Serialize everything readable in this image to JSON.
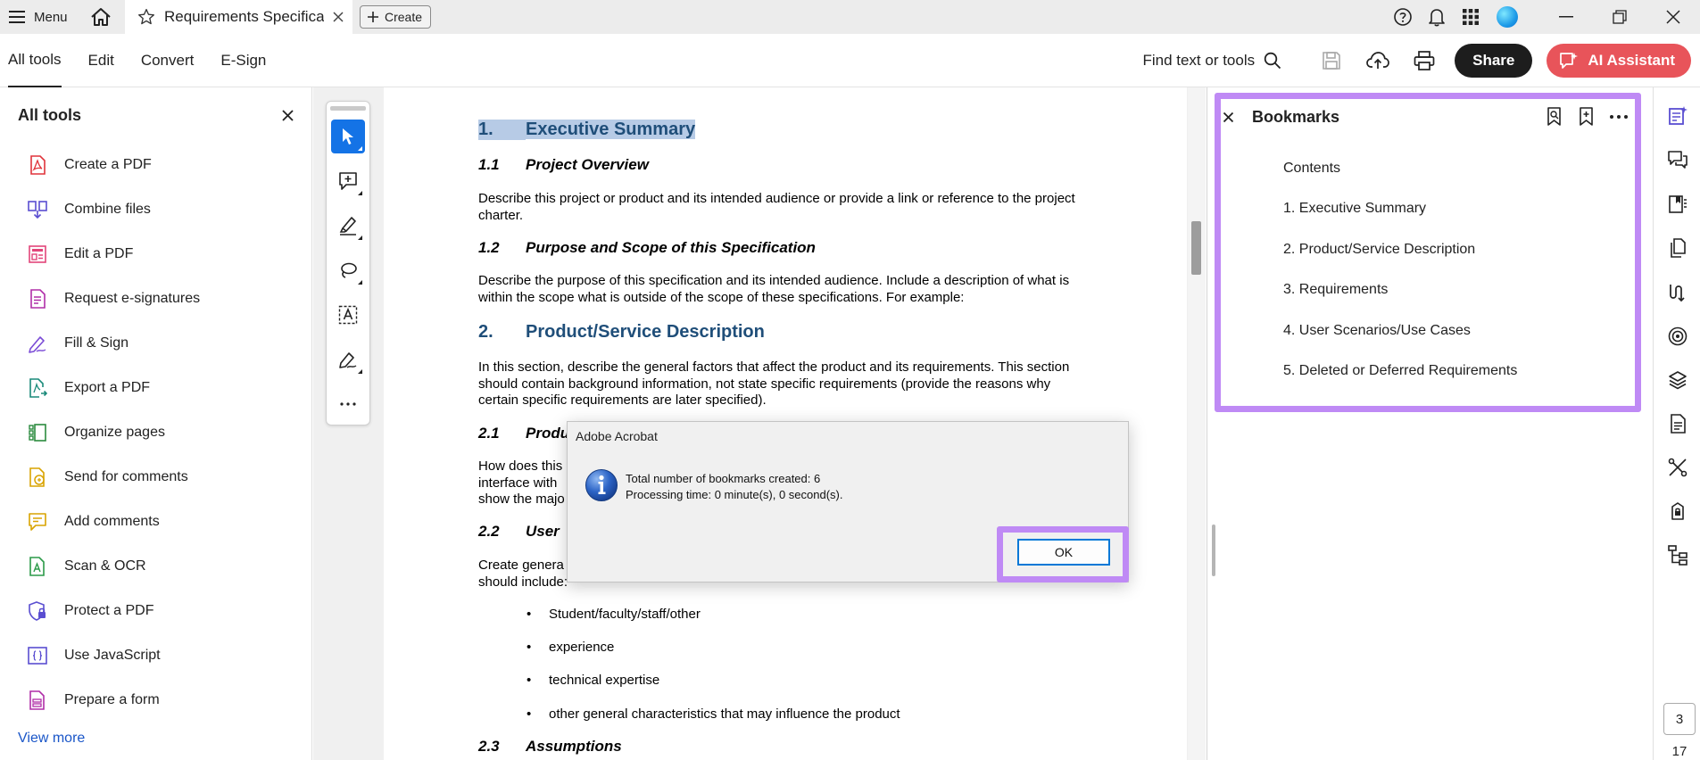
{
  "titlebar": {
    "menu_label": "Menu",
    "tab_title": "Requirements Specifica...",
    "create_label": "Create"
  },
  "toolbar": {
    "tabs": [
      {
        "label": "All tools",
        "active": true
      },
      {
        "label": "Edit"
      },
      {
        "label": "Convert"
      },
      {
        "label": "E-Sign"
      }
    ],
    "find_label": "Find text or tools",
    "share_label": "Share",
    "ai_label": "AI Assistant"
  },
  "left_panel": {
    "title": "All tools",
    "items": [
      {
        "label": "Create a PDF",
        "icon": "create-pdf-icon"
      },
      {
        "label": "Combine files",
        "icon": "combine-files-icon"
      },
      {
        "label": "Edit a PDF",
        "icon": "edit-pdf-icon"
      },
      {
        "label": "Request e-signatures",
        "icon": "request-esign-icon"
      },
      {
        "label": "Fill & Sign",
        "icon": "fill-sign-icon"
      },
      {
        "label": "Export a PDF",
        "icon": "export-pdf-icon"
      },
      {
        "label": "Organize pages",
        "icon": "organize-pages-icon"
      },
      {
        "label": "Send for comments",
        "icon": "send-comments-icon"
      },
      {
        "label": "Add comments",
        "icon": "add-comments-icon"
      },
      {
        "label": "Scan & OCR",
        "icon": "scan-ocr-icon"
      },
      {
        "label": "Protect a PDF",
        "icon": "protect-pdf-icon"
      },
      {
        "label": "Use JavaScript",
        "icon": "javascript-icon"
      },
      {
        "label": "Prepare a form",
        "icon": "prepare-form-icon"
      }
    ],
    "view_more": "View more"
  },
  "document": {
    "h1_1_num": "1.",
    "h1_1_text": "Executive Summary",
    "h2_1_1_num": "1.1",
    "h2_1_1_text": "Project Overview",
    "p_1_1": "Describe this project or product and its intended audience or provide a link or reference to the project charter.",
    "h2_1_2_num": "1.2",
    "h2_1_2_text": "Purpose and Scope of this Specification",
    "p_1_2": "Describe the purpose of this specification and its intended audience.   Include a description of what is within the scope what is outside of the scope of these specifications.  For example:",
    "h1_2_num": "2.",
    "h1_2_text": "Product/Service Description",
    "p_2": "In this section, describe the general factors that affect the product and its requirements. This section should contain background information, not state specific requirements (provide the reasons why certain specific requirements are later specified).",
    "h2_2_1_num": "2.1",
    "h2_2_1_text": "Produ",
    "p_2_1_a": "How does this",
    "p_2_1_b": "interface with",
    "p_2_1_c": "show the majo",
    "h2_2_2_num": "2.2",
    "h2_2_2_text": "User",
    "p_2_2_a": "Create genera",
    "p_2_2_b": "should include:",
    "bullets": [
      "Student/faculty/staff/other",
      "experience",
      "technical expertise",
      "other general characteristics that may influence the product"
    ],
    "h2_2_3_num": "2.3",
    "h2_2_3_text": "Assumptions"
  },
  "bookmarks": {
    "title": "Bookmarks",
    "items": [
      "Contents",
      "1. Executive Summary",
      "2. Product/Service Description",
      "3. Requirements",
      "4. User Scenarios/Use Cases",
      "5. Deleted or Deferred Requirements"
    ]
  },
  "page_nav": {
    "current": "3",
    "total": "17"
  },
  "dialog": {
    "title": "Adobe Acrobat",
    "line1": "Total number of bookmarks created: 6",
    "line2": "Processing time: 0 minute(s), 0 second(s).",
    "ok_label": "OK"
  }
}
